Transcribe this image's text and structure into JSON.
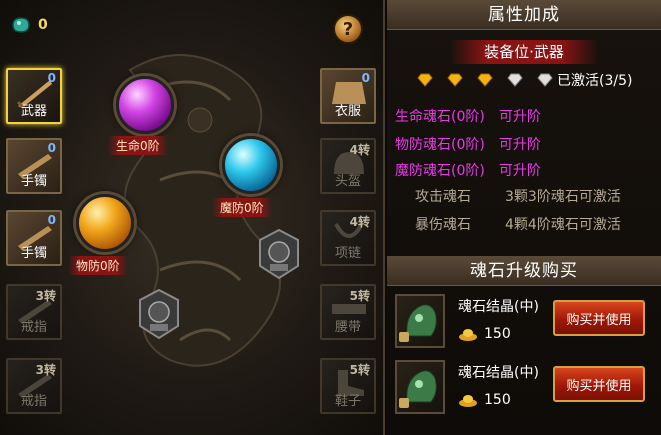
{
  "currency": {
    "icon": "jade-gem-icon",
    "value": "0"
  },
  "help": {
    "label": "?"
  },
  "left_slots": [
    {
      "name": "武器",
      "badge": "0",
      "badge_type": "level",
      "state": "selected"
    },
    {
      "name": "手镯",
      "badge": "0",
      "badge_type": "level",
      "state": "active"
    },
    {
      "name": "手镯",
      "badge": "0",
      "badge_type": "level",
      "state": "active"
    },
    {
      "name": "戒指",
      "badge": "3转",
      "badge_type": "turn",
      "state": "locked"
    },
    {
      "name": "戒指",
      "badge": "3转",
      "badge_type": "turn",
      "state": "locked"
    }
  ],
  "right_slots": [
    {
      "name": "衣服",
      "badge": "0",
      "badge_type": "level",
      "state": "active"
    },
    {
      "name": "头盔",
      "badge": "4转",
      "badge_type": "turn",
      "state": "locked"
    },
    {
      "name": "项链",
      "badge": "4转",
      "badge_type": "turn",
      "state": "locked"
    },
    {
      "name": "腰带",
      "badge": "5转",
      "badge_type": "turn",
      "state": "locked"
    },
    {
      "name": "鞋子",
      "badge": "5转",
      "badge_type": "turn",
      "state": "locked"
    }
  ],
  "orbs": [
    {
      "label": "生命0阶",
      "color": "#d246e6"
    },
    {
      "label": "魔防0阶",
      "color": "#2ec8ec"
    },
    {
      "label": "物防0阶",
      "color": "#f2a81c"
    }
  ],
  "attributes": {
    "header": "属性加成",
    "equip_title": "装备位·武器",
    "activated_text": "已激活(3/5)",
    "diamonds": [
      "gold",
      "gold",
      "gold",
      "silver",
      "silver"
    ],
    "stones": [
      {
        "name": "生命魂石(0阶)",
        "status": "可升阶"
      },
      {
        "name": "物防魂石(0阶)",
        "status": "可升阶"
      },
      {
        "name": "魔防魂石(0阶)",
        "status": "可升阶"
      }
    ],
    "bonuses": [
      {
        "name": "攻击魂石",
        "requirement": "3颗3阶魂石可激活"
      },
      {
        "name": "暴伤魂石",
        "requirement": "4颗4阶魂石可激活"
      }
    ]
  },
  "shop": {
    "header": "魂石升级购买",
    "items": [
      {
        "name": "魂石结晶(中)",
        "price": "150",
        "button": "购买并使用"
      },
      {
        "name": "魂石结晶(中)",
        "price": "150",
        "button": "购买并使用"
      }
    ]
  },
  "colors": {
    "accent_gold": "#f2d43a",
    "stone_text": "#e838e8",
    "banner_red": "#8a1414"
  }
}
